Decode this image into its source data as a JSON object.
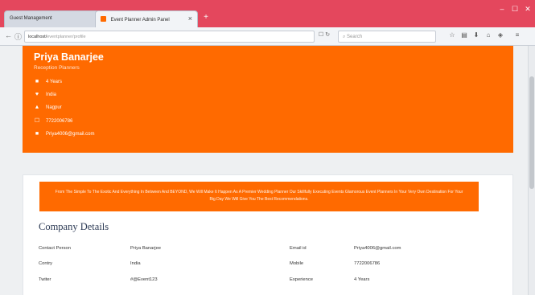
{
  "browser": {
    "tabs": [
      {
        "label": "Guest Management",
        "active": false
      },
      {
        "label": "Event Planner Admin Panel",
        "active": true
      }
    ],
    "new_tab_label": "+",
    "window_controls": [
      "–",
      "☐",
      "✕"
    ],
    "url": "localhost/",
    "url_rest": "eventplanner/profile",
    "search_placeholder": "Search",
    "icons": [
      "star-icon",
      "reader-icon",
      "download-icon",
      "home-icon",
      "pocket-icon",
      "menu-icon"
    ]
  },
  "profile": {
    "name": "Priya Banarjee",
    "role": "Reception Planners",
    "details": [
      {
        "icon": "briefcase-icon",
        "glyph": "■",
        "text": "4 Years"
      },
      {
        "icon": "location-pin-icon",
        "glyph": "♥",
        "text": "India"
      },
      {
        "icon": "home-icon",
        "glyph": "▲",
        "text": "Nagpur"
      },
      {
        "icon": "phone-icon",
        "glyph": "☐",
        "text": "7722006786"
      },
      {
        "icon": "envelope-icon",
        "glyph": "■",
        "text": "Priya4006@gmail.com"
      }
    ]
  },
  "company": {
    "banner_text": "From The Simple To The Exotic And Everything In Between And BEYOND, We Will Make It Happen As A Premier Wedding Planner Our Skillfully Executing Events Glamorous Event Planners In Your Very Own Destination For Your Big Day We Will Give You The Best Recommendations.",
    "title": "Company Details",
    "left_rows": [
      {
        "label": "Contact Person",
        "value": "Priya Banarjee"
      },
      {
        "label": "Contry",
        "value": "India"
      },
      {
        "label": "Twiter",
        "value": "#@Event123"
      }
    ],
    "right_rows": [
      {
        "label": "Email id",
        "value": "Priya4006@gmail.com"
      },
      {
        "label": "Mobile",
        "value": "7722006786"
      },
      {
        "label": "Experience",
        "value": "4 Years"
      }
    ]
  },
  "colors": {
    "accent": "#ff6a00",
    "titlebar": "#e4475d"
  }
}
